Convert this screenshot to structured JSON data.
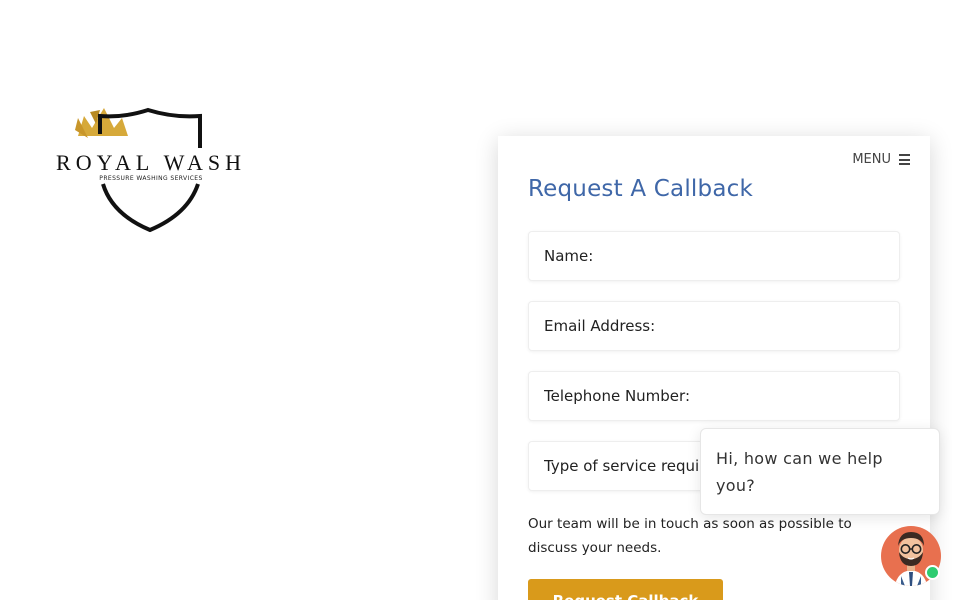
{
  "logo": {
    "title": "ROYAL WASH",
    "subtitle": "PRESSURE WASHING SERVICES"
  },
  "nav": {
    "menu_label": "MENU"
  },
  "form": {
    "title": "Request A Callback",
    "fields": {
      "name": "Name:",
      "email": "Email Address:",
      "phone": "Telephone Number:",
      "service": "Type of service required:"
    },
    "note": "Our team will be in touch as soon as possible to discuss your needs.",
    "submit_label": "Request Callback"
  },
  "chat": {
    "greeting": "Hi, how can we help you?"
  },
  "colors": {
    "accent_blue": "#3f67a8",
    "button_gold": "#d99a1b",
    "avatar_bg": "#e8704f",
    "online": "#2ecc71"
  }
}
